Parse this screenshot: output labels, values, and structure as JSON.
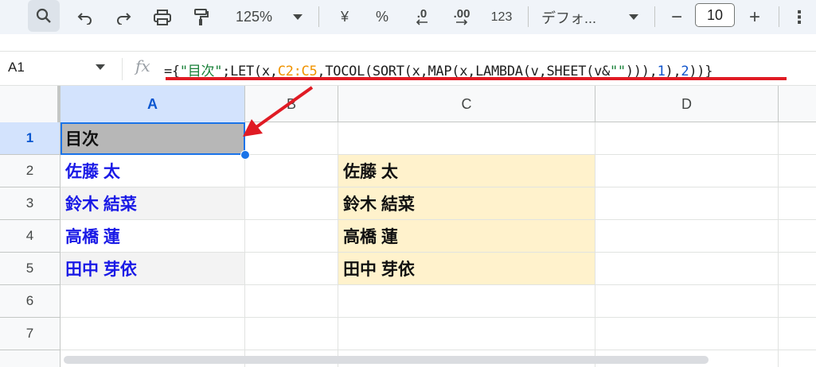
{
  "toolbar": {
    "zoom": "125%",
    "currency": "¥",
    "percent": "%",
    "decrease_decimal": ".0",
    "increase_decimal": ".00",
    "number_format": "123",
    "font_name": "デフォ...",
    "font_size": "10",
    "decrease_size": "−",
    "increase_size": "+",
    "more": "⋮"
  },
  "formula_bar": {
    "name_box": "A1",
    "fx": "fx",
    "formula_parts": {
      "p1": "={",
      "s1": "\"目次\"",
      "p2": ";LET(x,",
      "r1": "C2:C5",
      "p3": ",TOCOL(SORT(x,MAP(x,LAMBDA(v,SHEET(v&",
      "s2": "\"\"",
      "p4": "))),",
      "n1": "1",
      "p5": "),",
      "n2": "2",
      "p6": "))}"
    }
  },
  "columns": [
    "A",
    "B",
    "C",
    "D"
  ],
  "rows": [
    "1",
    "2",
    "3",
    "4",
    "5",
    "6",
    "7"
  ],
  "cells": {
    "A1": "目次",
    "A2": "佐藤 太",
    "A3": "鈴木 結菜",
    "A4": "高橋 蓮",
    "A5": "田中 芽依",
    "C2": "佐藤 太",
    "C3": "鈴木 結菜",
    "C4": "高橋 蓮",
    "C5": "田中 芽依"
  },
  "colors": {
    "annotation_red": "#e01b24",
    "selection_blue": "#1a73e8",
    "link_blue": "#1a1ae6",
    "highlight_yellow": "#fff2cc",
    "header_grey": "#b7b7b7"
  }
}
